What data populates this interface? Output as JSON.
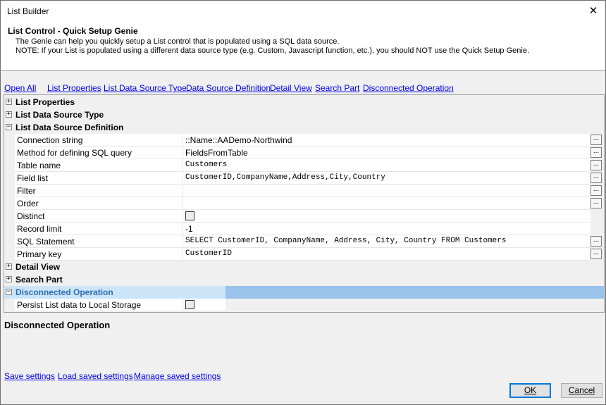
{
  "window": {
    "title": "List Builder",
    "close_glyph": "✕"
  },
  "header": {
    "title": "List Control - Quick Setup Genie",
    "line1": "The Genie can help you quickly setup a List control that is populated using a SQL data source.",
    "line2": "NOTE: If your List is populated using a different data source type (e.g. Custom, Javascript function, etc.), you should NOT use the Quick Setup Genie."
  },
  "nav_links": {
    "open_all": "Open All",
    "list_properties": "List Properties",
    "list_data_source_type": "List Data Source Type",
    "data_source_definition": "Data Source Definition",
    "detail_view": "Detail View",
    "search_part": "Search Part",
    "disconnected_operation": "Disconnected Operation"
  },
  "grid": {
    "categories": {
      "list_properties": {
        "label": "List Properties",
        "expander": "+"
      },
      "list_data_source_type": {
        "label": "List Data Source Type",
        "expander": "+"
      },
      "list_data_source_definition": {
        "label": "List Data Source Definition",
        "expander": "−"
      },
      "detail_view": {
        "label": "Detail View",
        "expander": "+"
      },
      "search_part": {
        "label": "Search Part",
        "expander": "+"
      },
      "disconnected_operation": {
        "label": "Disconnected Operation",
        "expander": "−"
      }
    },
    "properties": {
      "connection_string": {
        "name": "Connection string",
        "value": "::Name::AADemo-Northwind"
      },
      "method_sql": {
        "name": "Method for defining SQL query",
        "value": "FieldsFromTable"
      },
      "table_name": {
        "name": "Table name",
        "value": "Customers"
      },
      "field_list": {
        "name": "Field list",
        "value": "CustomerID,CompanyName,Address,City,Country"
      },
      "filter": {
        "name": "Filter",
        "value": ""
      },
      "order": {
        "name": "Order",
        "value": ""
      },
      "distinct": {
        "name": "Distinct",
        "checked": false
      },
      "record_limit": {
        "name": "Record limit",
        "value": "-1"
      },
      "sql_statement": {
        "name": "SQL Statement",
        "value": "SELECT CustomerID, CompanyName, Address, City, Country FROM Customers"
      },
      "primary_key": {
        "name": "Primary key",
        "value": "CustomerID"
      },
      "persist_local": {
        "name": "Persist List data to Local Storage",
        "checked": false
      }
    },
    "ellipsis": "..."
  },
  "info_panel": {
    "title": "Disconnected Operation"
  },
  "bottom_links": {
    "save": "Save settings",
    "load": "Load saved settings",
    "manage": "Manage saved settings"
  },
  "buttons": {
    "ok": "OK",
    "cancel": "Cancel"
  }
}
